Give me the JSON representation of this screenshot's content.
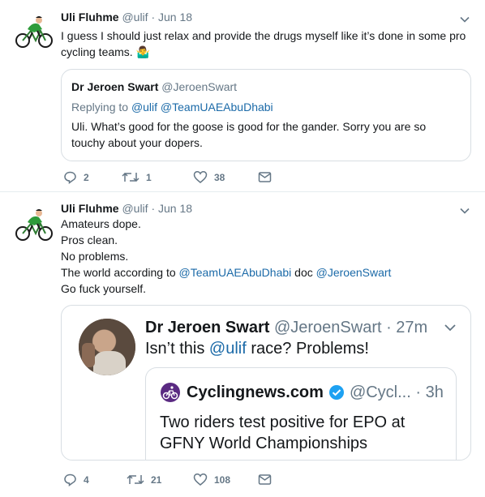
{
  "tweets": [
    {
      "author_name": "Uli Fluhme",
      "meta": "@ulif · Jun 18",
      "text_line1": "I guess I should just relax and provide the drugs myself like it’s done in some pro",
      "text_line2": "cycling teams. 🤷‍♂️",
      "quote": {
        "author_name": "Dr Jeroen Swart",
        "author_handle": "@JeroenSwart",
        "replying_label": "Replying to",
        "replying_to": "@ulif @TeamUAEAbuDhabi",
        "text_line1": "Uli. What’s good for the goose is good for the gander. Sorry you are so",
        "text_line2": "touchy about your dopers."
      },
      "actions": {
        "replies": "2",
        "retweets": "1",
        "likes": "38"
      }
    },
    {
      "author_name": "Uli Fluhme",
      "meta": "@ulif · Jun 18",
      "lines": {
        "l1": "Amateurs dope.",
        "l2": "Pros clean.",
        "l3": "No problems.",
        "l4_prefix": "The world according to ",
        "l4_link1": "@TeamUAEAbuDhabi",
        "l4_mid": " doc ",
        "l4_link2": "@JeroenSwart",
        "l5": "Go fuck yourself."
      },
      "quote": {
        "author_name": "Dr Jeroen Swart",
        "author_meta": "@JeroenSwart · 27m",
        "text_prefix": "Isn’t this ",
        "text_link": "@ulif",
        "text_suffix": " race? Problems!",
        "inner": {
          "name": "Cyclingnews.com",
          "meta": "@Cycl... · 3h",
          "text_line1": "Two riders test positive for EPO at",
          "text_line2": "GFNY World Championships"
        }
      },
      "actions": {
        "replies": "4",
        "retweets": "21",
        "likes": "108"
      }
    }
  ],
  "colors": {
    "accent": "#1da1f2",
    "link": "#1b6aa8",
    "muted": "#657786",
    "border": "#e6ecf0",
    "verified": "#1da1f2",
    "cyclingnews": "#5a2a82"
  },
  "icons": [
    "cyclist-avatar",
    "chevron-down-icon",
    "reply-icon",
    "retweet-icon",
    "like-icon",
    "dm-icon",
    "verified-badge-icon",
    "cyclingnews-logo"
  ]
}
